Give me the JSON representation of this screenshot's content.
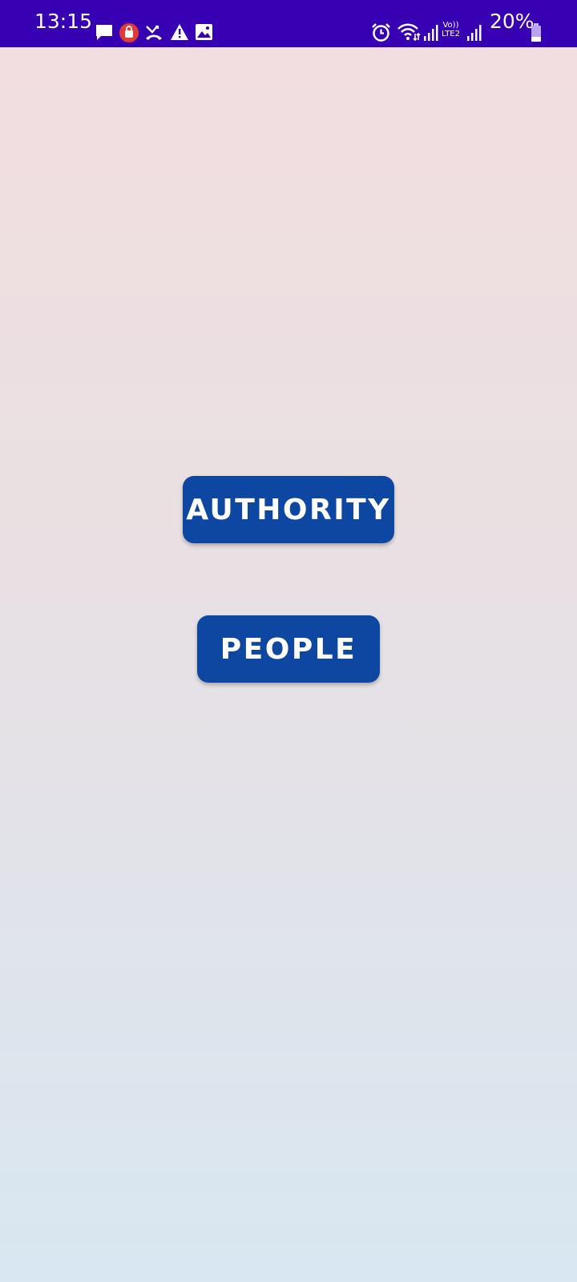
{
  "status_bar": {
    "time": "13:15",
    "battery": "20%",
    "network_top": "Vo))",
    "network_bottom": "LTE2",
    "background": "#3700b3",
    "left_icons": [
      "message-icon",
      "shopping-bag-notification-icon",
      "missed-call-icon",
      "warning-icon",
      "image-icon"
    ],
    "right_icons": [
      "alarm-icon",
      "wifi-icon",
      "signal-icon",
      "signal-icon",
      "battery-icon"
    ]
  },
  "main": {
    "buttons": [
      {
        "label": "AUTHORITY"
      },
      {
        "label": "PEOPLE"
      }
    ],
    "button_color": "#0d47a1",
    "background_top": "#f3dedf",
    "background_bottom": "#d8e7f1"
  }
}
